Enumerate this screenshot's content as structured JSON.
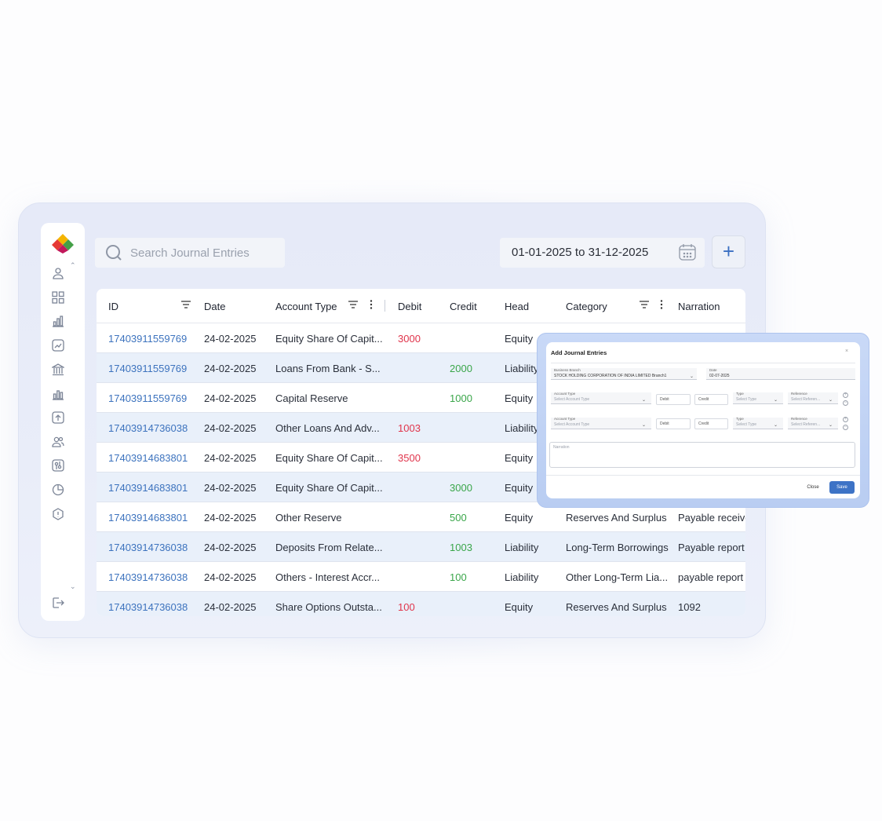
{
  "search": {
    "placeholder": "Search Journal Entries"
  },
  "date_range": "01-01-2025 to 31-12-2025",
  "add_button": "+",
  "sidebar": {
    "icons": [
      "user-icon",
      "dashboard-icon",
      "bar-chart-icon",
      "report-icon",
      "bank-icon",
      "analytics-icon",
      "upload-icon",
      "users-icon",
      "settings-icon",
      "pie-chart-icon",
      "info-icon"
    ],
    "logout": "logout-icon"
  },
  "table": {
    "columns": [
      "ID",
      "Date",
      "Account Type",
      "Debit",
      "Credit",
      "Head",
      "Category",
      "Narration"
    ],
    "rows": [
      {
        "id": "17403911559769",
        "date": "24-02-2025",
        "account": "Equity Share Of Capit...",
        "debit": "3000",
        "credit": "",
        "head": "Equity",
        "category": "",
        "narration": ""
      },
      {
        "id": "17403911559769",
        "date": "24-02-2025",
        "account": "Loans From Bank - S...",
        "debit": "",
        "credit": "2000",
        "head": "Liability",
        "category": "",
        "narration": ""
      },
      {
        "id": "17403911559769",
        "date": "24-02-2025",
        "account": "Capital Reserve",
        "debit": "",
        "credit": "1000",
        "head": "Equity",
        "category": "",
        "narration": ""
      },
      {
        "id": "17403914736038",
        "date": "24-02-2025",
        "account": "Other Loans And Adv...",
        "debit": "1003",
        "credit": "",
        "head": "Liability",
        "category": "",
        "narration": ""
      },
      {
        "id": "17403914683801",
        "date": "24-02-2025",
        "account": "Equity Share Of Capit...",
        "debit": "3500",
        "credit": "",
        "head": "Equity",
        "category": "",
        "narration": ""
      },
      {
        "id": "17403914683801",
        "date": "24-02-2025",
        "account": "Equity Share Of Capit...",
        "debit": "",
        "credit": "3000",
        "head": "Equity",
        "category": "",
        "narration": ""
      },
      {
        "id": "17403914683801",
        "date": "24-02-2025",
        "account": "Other Reserve",
        "debit": "",
        "credit": "500",
        "head": "Equity",
        "category": "Reserves And Surplus",
        "narration": "Payable receive"
      },
      {
        "id": "17403914736038",
        "date": "24-02-2025",
        "account": "Deposits From Relate...",
        "debit": "",
        "credit": "1003",
        "head": "Liability",
        "category": "Long-Term Borrowings",
        "narration": "Payable report"
      },
      {
        "id": "17403914736038",
        "date": "24-02-2025",
        "account": "Others - Interest Accr...",
        "debit": "",
        "credit": "100",
        "head": "Liability",
        "category": "Other Long-Term Lia...",
        "narration": "payable report"
      },
      {
        "id": "17403914736038",
        "date": "24-02-2025",
        "account": "Share Options Outsta...",
        "debit": "100",
        "credit": "",
        "head": "Equity",
        "category": "Reserves And Surplus",
        "narration": "1092"
      }
    ]
  },
  "modal": {
    "title": "Add Journal Entries",
    "close_x": "×",
    "business_branch_label": "Business Branch",
    "business_branch_value": "STOCK HOLDING CORPORATION OF INDIA LIMITED Branch1",
    "date_label": "Date",
    "date_value": "02-07-2025",
    "lines": [
      {
        "account_label": "Account Type",
        "account_placeholder": "Select Account Type",
        "debit": "Debit",
        "credit": "Credit",
        "type_label": "Type",
        "type_placeholder": "Select Type",
        "reference_label": "Reference",
        "reference_placeholder": "Select Referen..."
      },
      {
        "account_label": "Account Type",
        "account_placeholder": "Select Account Type",
        "debit": "Debit",
        "credit": "Credit",
        "type_label": "Type",
        "type_placeholder": "Select Type",
        "reference_label": "Reference",
        "reference_placeholder": "Select Referen..."
      }
    ],
    "narration_placeholder": "Narration",
    "close_button": "Close",
    "save_button": "Save"
  },
  "colors": {
    "accent": "#3d73c6",
    "id_link": "#3d73be",
    "debit": "#e0344b",
    "credit": "#3aa64a",
    "row_alt": "#e9f0fa"
  }
}
